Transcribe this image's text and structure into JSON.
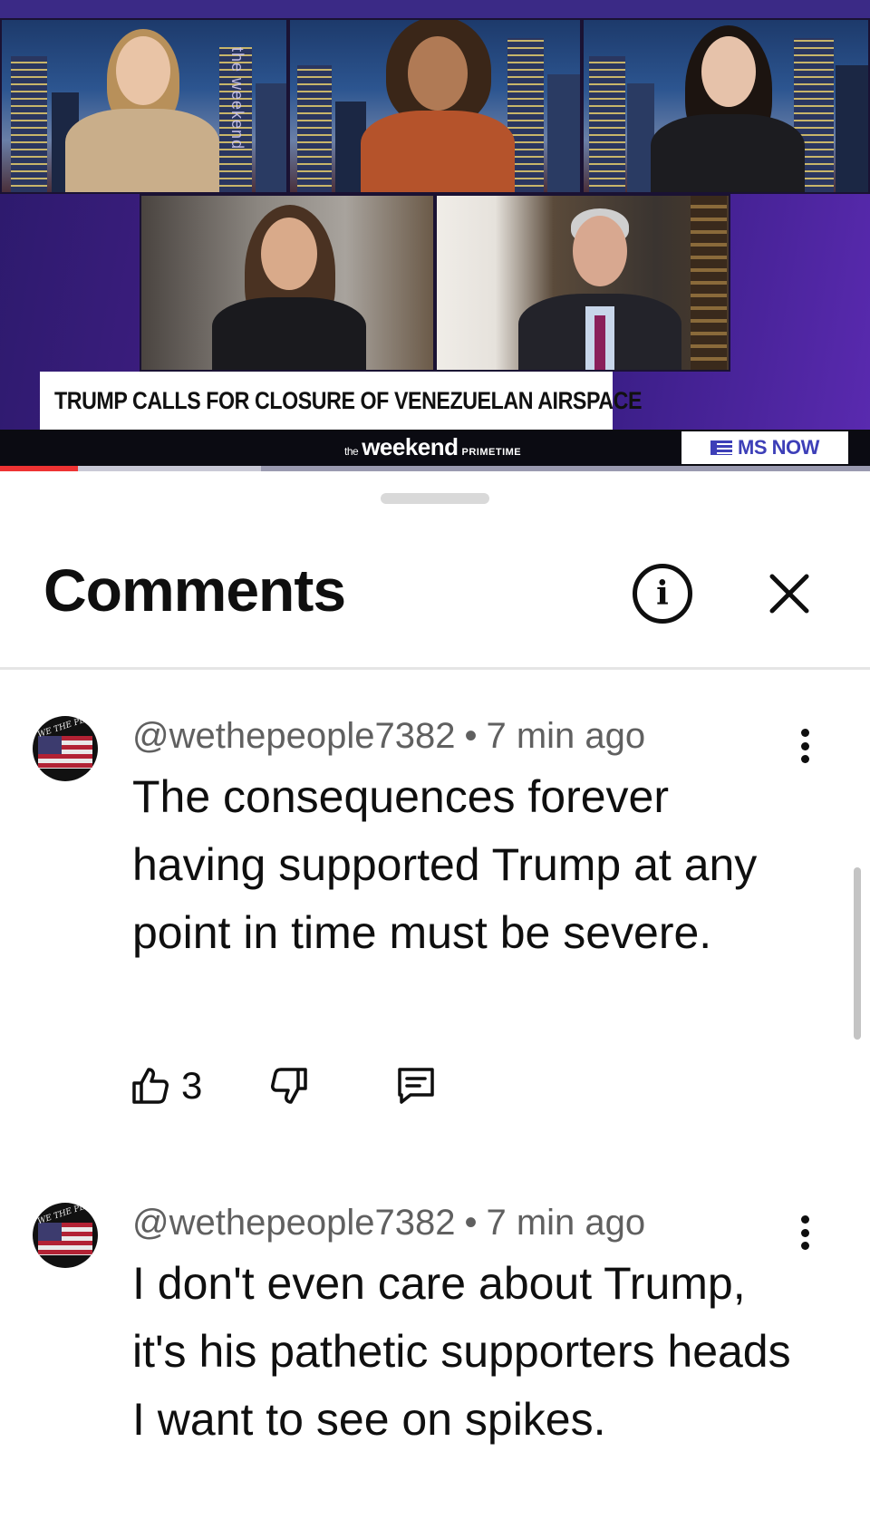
{
  "video": {
    "chyron": "TRUMP CALLS FOR CLOSURE OF VENEZUELAN AIRSPACE",
    "show_prefix": "the",
    "show_name": "weekend",
    "show_suffix": "PRIMETIME",
    "network": "MS NOW",
    "side_tag": "the weekend",
    "progress": 0.09,
    "buffered": 0.3
  },
  "sheet": {
    "title": "Comments"
  },
  "comments": [
    {
      "author": "@wethepeople7382",
      "separator": "•",
      "time": "7 min ago",
      "avatar_text": "WE THE PEOPLE",
      "text": "The consequences forever having supported Trump at any point in time must be severe.",
      "likes": "3"
    },
    {
      "author": "@wethepeople7382",
      "separator": "•",
      "time": "7 min ago",
      "avatar_text": "WE THE PEOPLE",
      "text": "I don't even care about Trump, it's his pathetic supporters heads I want to see on spikes."
    }
  ],
  "colors": {
    "brand_blue": "#3d3fb8",
    "progress_red": "#ee3333",
    "text_primary": "#0f0f0f",
    "text_secondary": "#606060"
  },
  "icons": [
    "info-icon",
    "close-icon",
    "more-vert-icon",
    "thumb-up-icon",
    "thumb-down-icon",
    "reply-icon"
  ]
}
